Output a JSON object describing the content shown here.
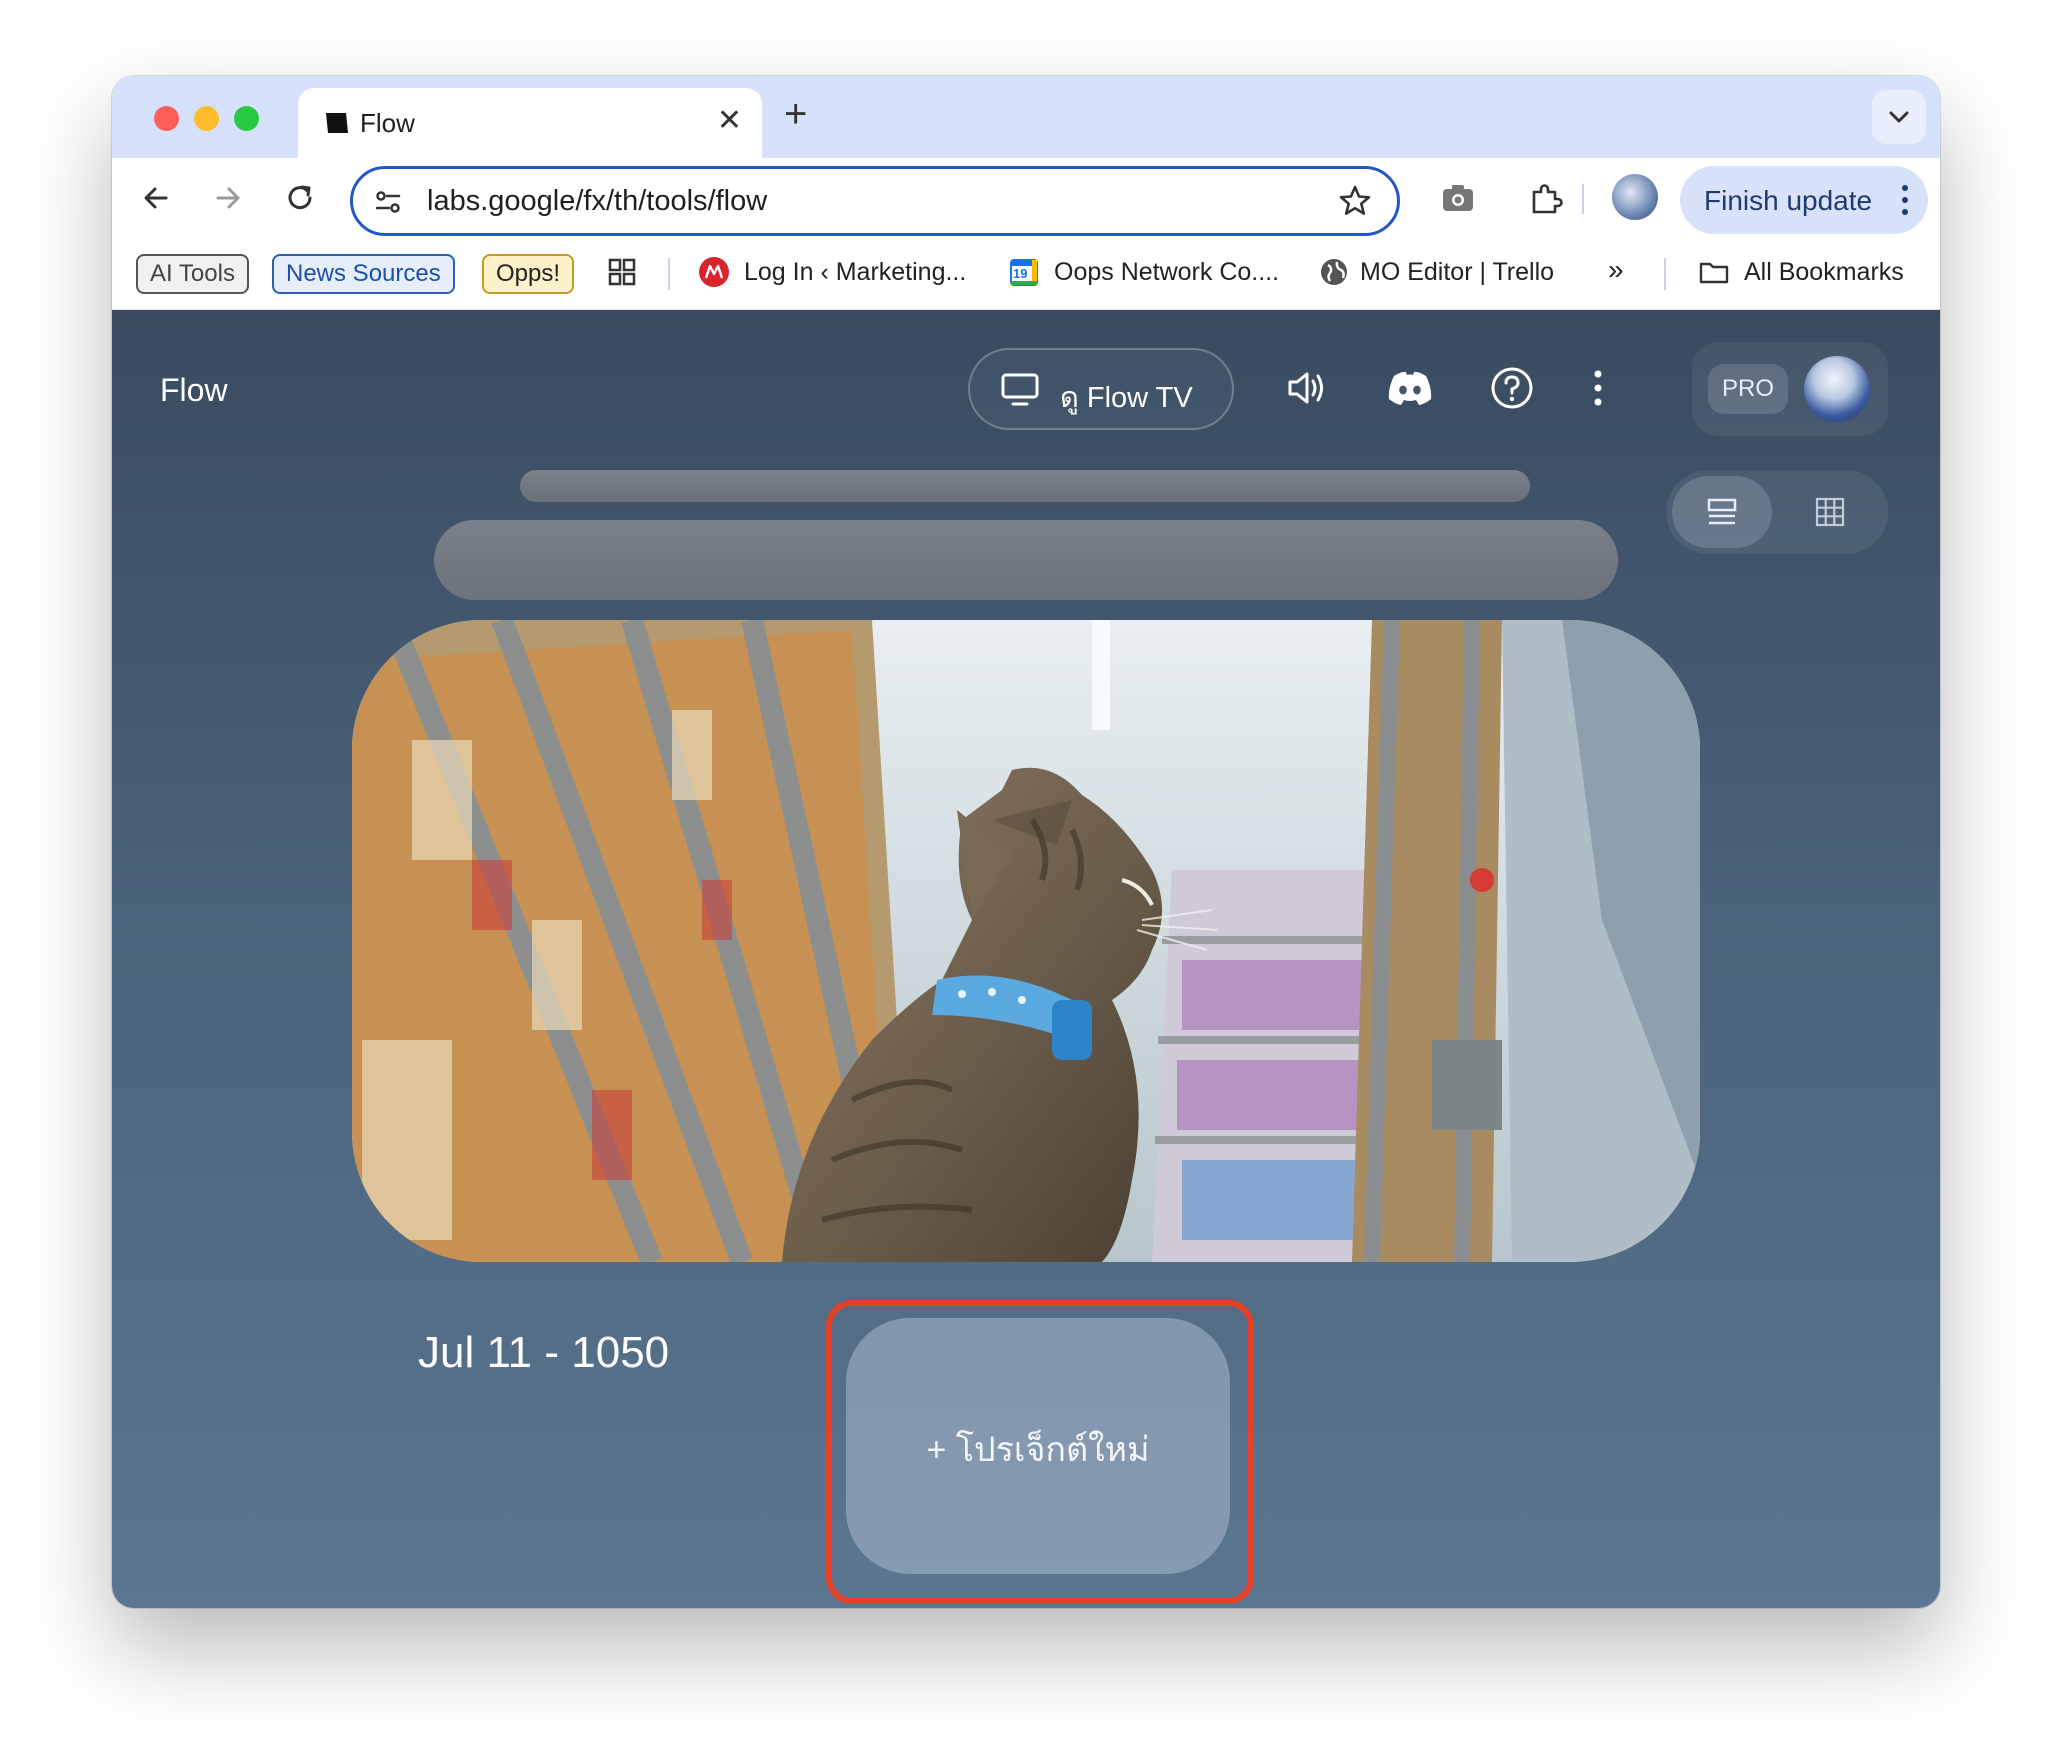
{
  "browser": {
    "tab": {
      "title": "Flow"
    },
    "address_bar": {
      "url": "labs.google/fx/th/tools/flow"
    },
    "finish_update_label": "Finish update",
    "bookmarks": {
      "chips": [
        "AI Tools",
        "News Sources",
        "Opps!"
      ],
      "items": [
        "Log In ‹ Marketing...",
        "Oops Network Co....",
        "MO Editor | Trello"
      ],
      "overflow": "»",
      "all_bookmarks": "All Bookmarks",
      "calendar_day": "19"
    }
  },
  "app": {
    "title": "Flow",
    "flow_tv_label": "ดู Flow TV",
    "pro_badge": "PRO",
    "project": {
      "title": "Jul 11 - 1050"
    },
    "new_project_label": "+ โปรเจ็กต์ใหม่"
  },
  "colors": {
    "highlight": "#e64029",
    "address_focus": "#2457c5",
    "tab_strip": "#d6e2fb"
  }
}
